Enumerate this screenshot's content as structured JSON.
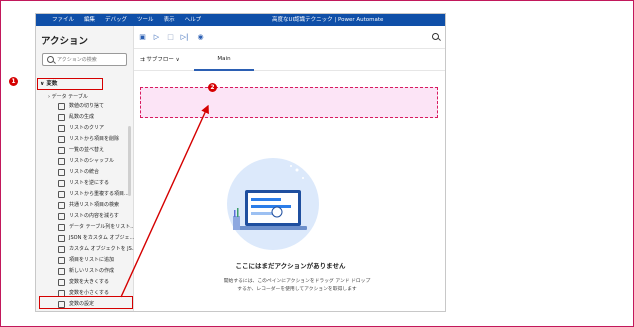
{
  "app": {
    "menu": [
      "ファイル",
      "編集",
      "デバッグ",
      "ツール",
      "表示",
      "ヘルプ"
    ],
    "window_title": "高度なUI認識テクニック | Power Automate"
  },
  "sidebar": {
    "title": "アクション",
    "search_placeholder": "アクションの検索",
    "category": "変数",
    "subcategory": "データ テーブル",
    "items": [
      {
        "label": "数値の切り捨て",
        "icon": "number-icon"
      },
      {
        "label": "乱数の生成",
        "icon": "dice-icon"
      },
      {
        "label": "リストのクリア",
        "icon": "list-clear-icon"
      },
      {
        "label": "リストから項目を削除",
        "icon": "list-remove-icon"
      },
      {
        "label": "一覧の並べ替え",
        "icon": "sort-icon"
      },
      {
        "label": "リストのシャッフル",
        "icon": "shuffle-icon"
      },
      {
        "label": "リストの統合",
        "icon": "merge-icon"
      },
      {
        "label": "リストを逆にする",
        "icon": "reverse-icon"
      },
      {
        "label": "リストから重複する項目...",
        "icon": "duplicate-icon"
      },
      {
        "label": "共通リスト項目の検索",
        "icon": "common-list-icon"
      },
      {
        "label": "リストの内容を減らす",
        "icon": "subtract-list-icon"
      },
      {
        "label": "データ テーブル列をリスト...",
        "icon": "table-column-icon"
      },
      {
        "label": "JSON をカスタム オブジェ...",
        "icon": "json-icon"
      },
      {
        "label": "カスタム オブジェクトを JS...",
        "icon": "custom-object-icon"
      },
      {
        "label": "項目をリストに追加",
        "icon": "add-item-icon"
      },
      {
        "label": "新しいリストの作成",
        "icon": "new-list-icon"
      },
      {
        "label": "変数を大きくする",
        "icon": "increase-icon"
      },
      {
        "label": "変数を小さくする",
        "icon": "decrease-icon"
      },
      {
        "label": "変数の設定",
        "icon": "set-variable-icon"
      }
    ]
  },
  "main": {
    "subflow_label": "サブフロー",
    "tab_main": "Main",
    "empty_title": "ここにはまだアクションがありません",
    "empty_desc_line1": "開始するには、このペインにアクションをドラッグ アンド ドロップ",
    "empty_desc_line2": "するか、レコーダーを使用してアクションを取得します"
  },
  "annotations": {
    "badge1": "1",
    "badge2": "2"
  },
  "colors": {
    "accent": "#2b5fb3",
    "titlebar": "#0f4fa8",
    "highlight": "#d50000",
    "dropzone_fill": "#fce4f6"
  }
}
